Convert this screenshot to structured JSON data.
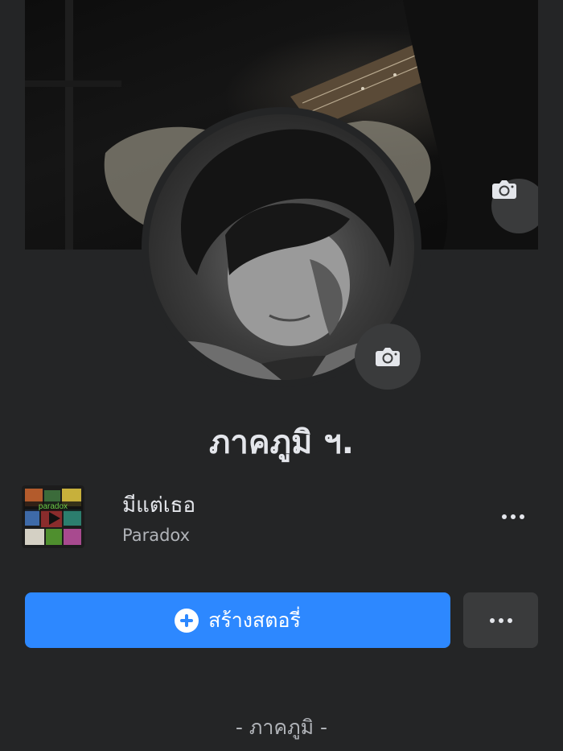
{
  "profile": {
    "name": "ภาคภูมิ ฯ.",
    "bio": "- ภาคภูมิ -"
  },
  "cover": {
    "camera_icon": "camera-icon"
  },
  "avatar": {
    "camera_icon": "camera-icon"
  },
  "music": {
    "song_title": "มีแต่เธอ",
    "artist": "Paradox",
    "album_art_text": "paradox",
    "more_icon": "more-horizontal-icon"
  },
  "actions": {
    "add_story_label": "สร้างสตอรี่",
    "add_story_icon": "plus-circle-icon",
    "more_icon": "more-horizontal-icon"
  },
  "colors": {
    "background": "#242526",
    "primary_button": "#2d88ff",
    "secondary_button": "#3a3b3c",
    "text_primary": "#e4e6eb",
    "text_secondary": "#b0b3b8"
  }
}
